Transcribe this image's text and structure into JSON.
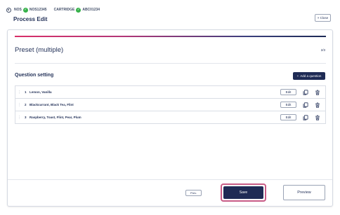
{
  "header": {
    "nos_label": "NOS",
    "nos_value": "NOS12345",
    "cartridge_label": "CARTRIDGE",
    "cartridge_value": "ABC01234",
    "title": "Process Edit",
    "close_label": "Close"
  },
  "panel": {
    "preset_title": "Preset (multiple)",
    "page_indicator": "2/3",
    "section_title": "Question setting",
    "add_question_label": "Add a question",
    "questions": [
      {
        "number": "1",
        "text": "Lemon, Vanilla",
        "edit_label": "Edit"
      },
      {
        "number": "2",
        "text": "Blackcurrant, Black Tea, Flint",
        "edit_label": "Edit"
      },
      {
        "number": "3",
        "text": "Raspberry, Toast, Flint, Pear, Plum",
        "edit_label": "Edit"
      }
    ]
  },
  "footer": {
    "prev_label": "Prev.",
    "save_label": "Save",
    "preview_label": "Preview"
  },
  "colors": {
    "primary": "#1f2b55",
    "status_ok": "#36b14a",
    "accent": "#d82f68"
  },
  "icons": {
    "settings": "gear-icon",
    "ok": "check-circle-icon",
    "close": "close-icon",
    "add": "plus-icon",
    "drag": "drag-handle-icon",
    "copy": "copy-icon",
    "delete": "trash-icon"
  }
}
